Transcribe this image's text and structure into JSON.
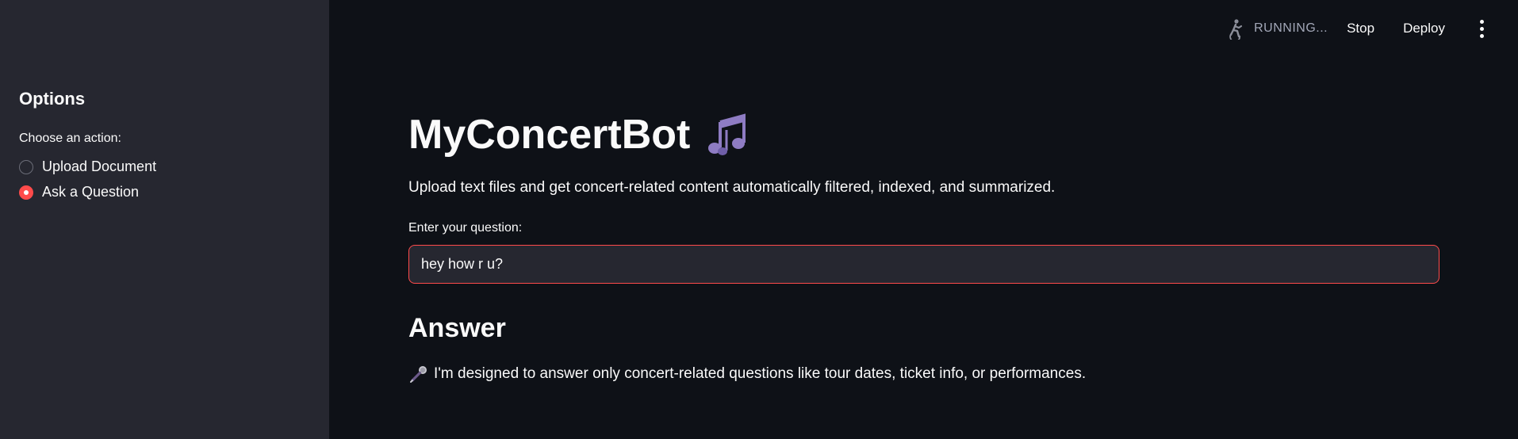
{
  "sidebar": {
    "title": "Options",
    "radio_label": "Choose an action:",
    "options": [
      {
        "label": "Upload Document",
        "selected": false
      },
      {
        "label": "Ask a Question",
        "selected": true
      }
    ]
  },
  "toolbar": {
    "status_icon": "running-person-icon",
    "status_text": "RUNNING...",
    "stop_label": "Stop",
    "deploy_label": "Deploy",
    "menu_icon": "more-vertical-icon"
  },
  "main": {
    "title": "MyConcertBot",
    "title_icon": "musical-notes-icon",
    "description": "Upload text files and get concert-related content automatically filtered, indexed, and summarized.",
    "question_label": "Enter your question:",
    "question_value": "hey how r u?",
    "answer_heading": "Answer",
    "answer_icon": "microphone-icon",
    "answer_text": "I'm designed to answer only concert-related questions like tour dates, ticket info, or performances."
  },
  "colors": {
    "background": "#0e1117",
    "sidebar": "#262730",
    "accent": "#ff4b4b",
    "text": "#fafafa",
    "muted": "#a3a8b8"
  }
}
